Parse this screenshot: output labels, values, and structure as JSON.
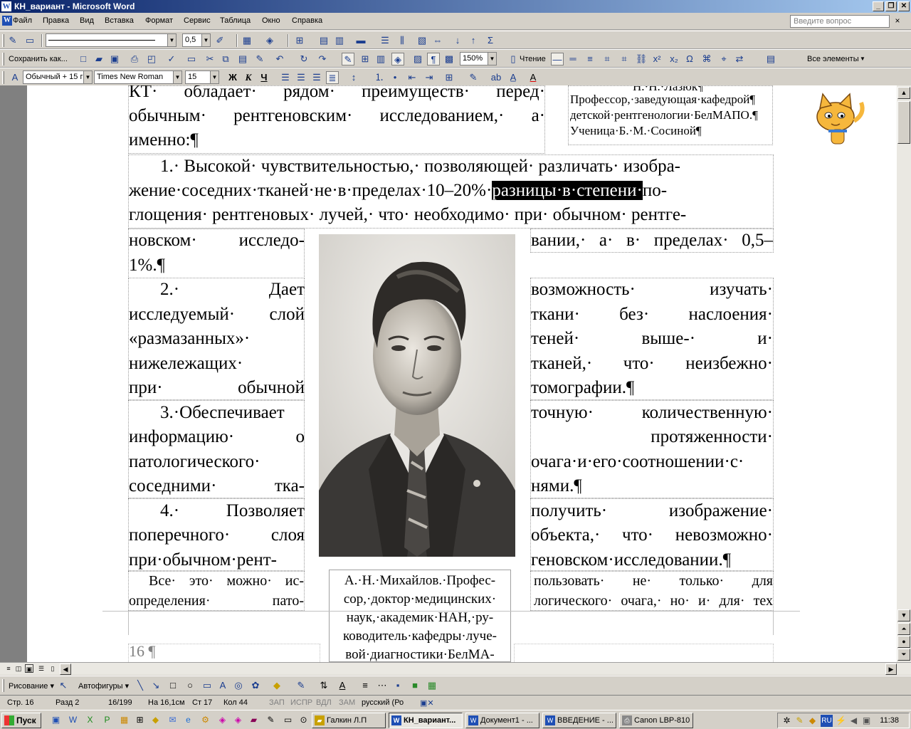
{
  "window": {
    "title": "КН_вариант - Microsoft Word",
    "minimize": "_",
    "restore": "❐",
    "close": "✕"
  },
  "menu": {
    "items": [
      "Файл",
      "Правка",
      "Вид",
      "Вставка",
      "Формат",
      "Сервис",
      "Таблица",
      "Окно",
      "Справка"
    ],
    "ask_placeholder": "Введите вопрос",
    "doc_close": "×"
  },
  "toolbar1": {
    "line_weight": "0,5"
  },
  "toolbar2": {
    "save_as": "Сохранить как...",
    "zoom": "150%",
    "reading": "Чтение",
    "all_elements": "Все элементы"
  },
  "toolbar3": {
    "style": "Обычный + 15 г",
    "font": "Times New Roman",
    "size": "15",
    "bold": "Ж",
    "italic": "К",
    "underline": "Ч"
  },
  "document": {
    "top_lines": [
      "КТ· обладает· рядом· преимуществ· перед·",
      "обычным· рентгеновским· исследованием,· а·",
      "именно:¶"
    ],
    "author_box": [
      "Н.·Н.·Лазюк¶",
      "Профессор,·заведующая·кафедрой¶",
      "детской·рентгенологии·БелМАПО.¶",
      "Ученица·Б.·М.·Сосиной¶"
    ],
    "point1_line1": "1.· Высокой· чувствительностью,· позволяющей· различать· изобра-",
    "point1_line2_a": "жение·соседних·тканей·не·в·пределах·10–20%·",
    "point1_line2_hl": "разницы·в·степени·",
    "point1_line2_b": "по-",
    "point1_line3": "глощения· рентгеновых· лучей,· что· необходимо· при· обычном· рентге-",
    "left_column": [
      [
        "новском·",
        "исследо-"
      ],
      [
        "1%.¶"
      ],
      [
        "2.·",
        "Дает"
      ],
      [
        "исследуемый·",
        "слой"
      ],
      [
        "«размазанных»·"
      ],
      [
        "нижележащих·"
      ],
      [
        "при·",
        "обычной"
      ],
      [
        "3.·Обеспечивает"
      ],
      [
        "информацию·",
        "о"
      ],
      [
        "патологического·"
      ],
      [
        "соседними·",
        "тка-"
      ],
      [
        "4.·",
        "Позволяет"
      ],
      [
        "поперечного·",
        "слоя"
      ],
      [
        "при·обычном·рент-"
      ]
    ],
    "right_column": [
      [
        "вании,·",
        "а·",
        "в·",
        "пределах·",
        "0,5–"
      ],
      [
        ""
      ],
      [
        "возможность·",
        "изучать·"
      ],
      [
        "ткани·",
        "без·",
        "наслоения·"
      ],
      [
        "теней·",
        "выше-·",
        "и·"
      ],
      [
        "тканей,·",
        "что·",
        "неизбежно·"
      ],
      [
        "томографии.¶"
      ],
      [
        "точную·",
        "количественную·"
      ],
      [
        "",
        "протяженности·"
      ],
      [
        "очага·и·его·соотношении·с·"
      ],
      [
        "нями.¶"
      ],
      [
        "получить·",
        "изображение·"
      ],
      [
        "объекта,·",
        "что·",
        "невозможно·"
      ],
      [
        "геновском·исследовании.¶"
      ]
    ],
    "bottom_left": [
      "Все· это· можно· ис-",
      "определения· пато-"
    ],
    "bottom_right": [
      "пользовать· не· только· для",
      "логического· очага,· но· и· для· тех"
    ],
    "caption": [
      "А.·Н.·Михайлов.·Профес-",
      "сор,·доктор·медицинских·",
      "наук,·академик·НАН,·ру-",
      "ководитель·кафедры·луче-",
      "вой·диагностики·БелМА-"
    ],
    "page_number": "16 ¶"
  },
  "drawing_toolbar": {
    "drawing": "Рисование",
    "autoshapes": "Автофигуры"
  },
  "status": {
    "page": "Стр. 16",
    "section": "Разд 2",
    "pages": "16/199",
    "at": "На 16,1см",
    "line": "Ст 17",
    "col": "Кол 44",
    "rec": "ЗАП",
    "trk": "ИСПР",
    "ext": "ВДЛ",
    "ovr": "ЗАМ",
    "lang": "русский (Ро"
  },
  "taskbar": {
    "start": "Пуск",
    "tasks": [
      "Галкин Л.П",
      "КН_вариант...",
      "Документ1 - ...",
      "ВВЕДЕНИЕ - ...",
      "Canon LBP-810"
    ],
    "lang": "RU",
    "time": "11:38"
  }
}
